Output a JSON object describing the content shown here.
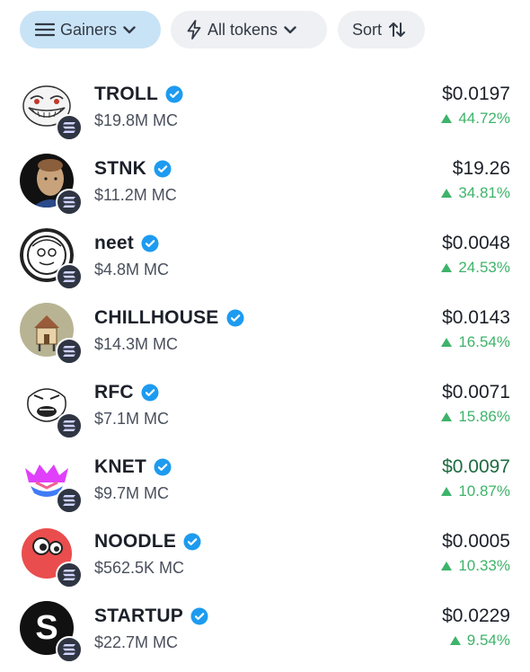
{
  "toolbar": {
    "filter_label": "Gainers",
    "tokens_label": "All tokens",
    "sort_label": "Sort"
  },
  "colors": {
    "accent_pill": "#c9e3f6",
    "pill": "#eef0f3",
    "gain": "#3eb36a",
    "verified": "#1d9bf0"
  },
  "tokens": [
    {
      "name": "TROLL",
      "market_cap": "$19.8M MC",
      "price": "$0.0197",
      "change": "44.72%",
      "icon": "troll-face-avatar-icon"
    },
    {
      "name": "STNK",
      "market_cap": "$11.2M MC",
      "price": "$19.26",
      "change": "34.81%",
      "icon": "stonks-man-avatar-icon"
    },
    {
      "name": "neet",
      "market_cap": "$4.8M MC",
      "price": "$0.0048",
      "change": "24.53%",
      "icon": "neet-face-avatar-icon"
    },
    {
      "name": "CHILLHOUSE",
      "market_cap": "$14.3M MC",
      "price": "$0.0143",
      "change": "16.54%",
      "icon": "chill-house-avatar-icon"
    },
    {
      "name": "RFC",
      "market_cap": "$7.1M MC",
      "price": "$0.0071",
      "change": "15.86%",
      "icon": "rage-face-avatar-icon"
    },
    {
      "name": "KNET",
      "market_cap": "$9.7M MC",
      "price": "$0.0097",
      "change": "10.87%",
      "icon": "knet-logo-avatar-icon"
    },
    {
      "name": "NOODLE",
      "market_cap": "$562.5K MC",
      "price": "$0.0005",
      "change": "10.33%",
      "icon": "noodle-blob-avatar-icon"
    },
    {
      "name": "STARTUP",
      "market_cap": "$22.7M MC",
      "price": "$0.0229",
      "change": "9.54%",
      "icon": "startup-s-logo-avatar-icon"
    }
  ]
}
